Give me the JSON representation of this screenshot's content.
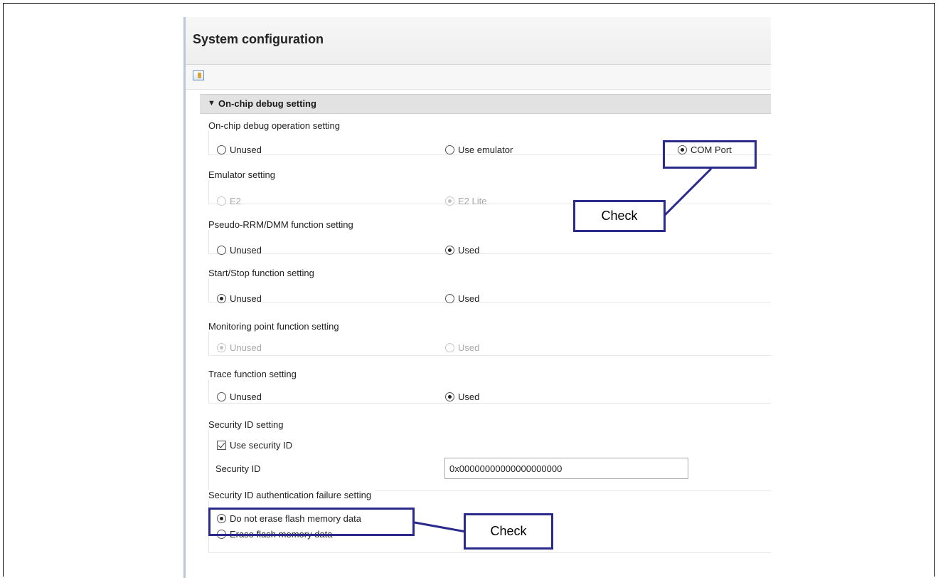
{
  "window": {
    "title": "System configuration"
  },
  "toolbar": {
    "icon": "generate-code-icon"
  },
  "section": {
    "label": "On-chip debug setting",
    "expanded": true
  },
  "groups": {
    "debug_op": {
      "title": "On-chip debug operation setting",
      "options": [
        "Unused",
        "Use emulator",
        "COM Port"
      ],
      "selected": "COM Port"
    },
    "emulator": {
      "title": "Emulator setting",
      "options": [
        "E2",
        "E2 Lite"
      ],
      "selected": "E2 Lite",
      "disabled": true
    },
    "pseudo": {
      "title": "Pseudo-RRM/DMM function setting",
      "options": [
        "Unused",
        "Used"
      ],
      "selected": "Used"
    },
    "startstop": {
      "title": "Start/Stop function setting",
      "options": [
        "Unused",
        "Used"
      ],
      "selected": "Unused"
    },
    "monitor": {
      "title": "Monitoring point function setting",
      "options": [
        "Unused",
        "Used"
      ],
      "selected": "Unused",
      "disabled": true
    },
    "trace": {
      "title": "Trace function setting",
      "options": [
        "Unused",
        "Used"
      ],
      "selected": "Used"
    },
    "security": {
      "title": "Security ID setting",
      "checkbox_label": "Use security ID",
      "checked": true,
      "id_label": "Security ID",
      "id_value": "0x00000000000000000000"
    },
    "auth_fail": {
      "title": "Security ID authentication failure setting",
      "options": [
        "Do not erase flash memory data",
        "Erase flash memory data"
      ],
      "selected": "Do not erase flash memory data"
    }
  },
  "callouts": {
    "top": "Check",
    "bottom": "Check"
  },
  "colors": {
    "highlight": "#2a2a8c",
    "section_bg": "#e2e2e2"
  }
}
